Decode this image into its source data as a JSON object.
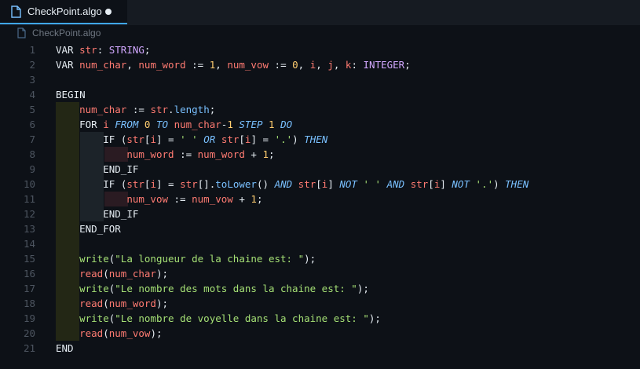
{
  "tab": {
    "label": "CheckPoint.algo",
    "icon": "file-icon",
    "modified": true
  },
  "breadcrumb": {
    "label": "CheckPoint.algo",
    "icon": "file-icon"
  },
  "editor": {
    "line_numbers": [
      "1",
      "2",
      "3",
      "4",
      "5",
      "6",
      "7",
      "8",
      "9",
      "10",
      "11",
      "12",
      "13",
      "14",
      "15",
      "16",
      "17",
      "18",
      "19",
      "20",
      "21"
    ],
    "lines": [
      "VAR str: STRING;",
      "VAR num_char, num_word := 1, num_vow := 0, i, j, k: INTEGER;",
      "",
      "BEGIN",
      "    num_char := str.length;",
      "    FOR i FROM 0 TO num_char-1 STEP 1 DO",
      "        IF (str[i] = ' ' OR str[i] = '.') THEN",
      "            num_word := num_word + 1;",
      "        END_IF",
      "        IF (str[i] = str[].toLower() AND str[i] NOT ' ' AND str[i] NOT '.') THEN",
      "            num_vow := num_vow + 1;",
      "        END_IF",
      "    END_FOR",
      "",
      "    write(\"La longueur de la chaine est: \");",
      "    read(num_char);",
      "    write(\"Le nombre des mots dans la chaine est: \");",
      "    read(num_word);",
      "    write(\"Le nombre de voyelle dans la chaine est: \");",
      "    read(num_vow);",
      "END"
    ]
  }
}
